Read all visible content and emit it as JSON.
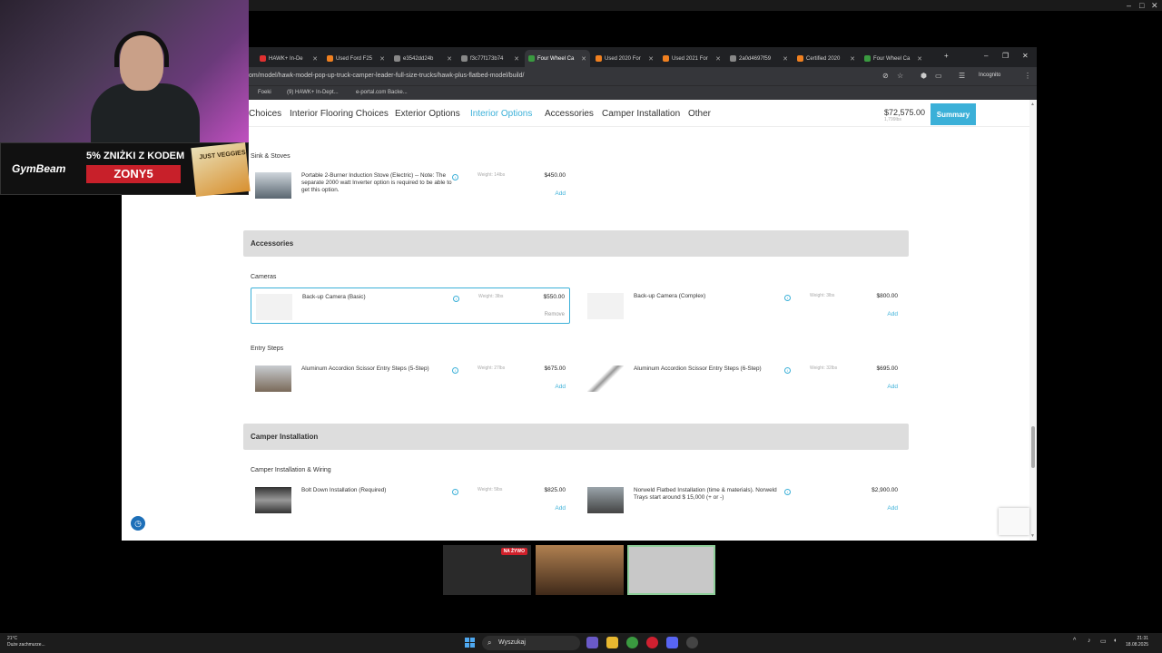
{
  "browser": {
    "tabs": [
      {
        "title": "HAWK+ In-De",
        "color": "#e03030"
      },
      {
        "title": "Used Ford F25",
        "color": "#f08020"
      },
      {
        "title": "e3542dd24b",
        "color": "#888888"
      },
      {
        "title": "f3c77f173b74",
        "color": "#888888"
      },
      {
        "title": "Four Wheel Ca",
        "color": "#3a9a40",
        "active": true
      },
      {
        "title": "Used 2020 For",
        "color": "#f08020"
      },
      {
        "title": "Used 2021 For",
        "color": "#f08020"
      },
      {
        "title": "2a0d4697f59",
        "color": "#888888"
      },
      {
        "title": "Certified 2020",
        "color": "#f08020"
      },
      {
        "title": "Four Wheel Ca",
        "color": "#3a9a40"
      }
    ],
    "url": "om/model/hawk-model-pop-up-truck-camper-leader-full-size-trucks/hawk-plus-flatbed-model/build/",
    "incognito_label": "Incognito",
    "bookmarks": [
      "Foeki",
      "(9) HAWK+ In-Dept...",
      "e-portal.com Backe..."
    ]
  },
  "nav": {
    "items": [
      "Choices",
      "Interior Flooring Choices",
      "Exterior Options",
      "Interior Options",
      "Accessories",
      "Camper Installation",
      "Other"
    ],
    "active_index": 3,
    "total_price": "$72,575.00",
    "total_weight": "1,799lbs",
    "summary_label": "Summary"
  },
  "sections": {
    "sink_stoves": "Sink & Stoves",
    "accessories": "Accessories",
    "cameras": "Cameras",
    "entry_steps": "Entry Steps",
    "camper_installation": "Camper Installation",
    "camper_wiring": "Camper Installation & Wiring"
  },
  "items": {
    "stove": {
      "name": "Portable 2-Burner Induction Stove (Electric) -- Note: The separate 2000 watt Inverter option is required to be able to get this option.",
      "weight": "Weight: 14lbs",
      "price": "$450.00",
      "action": "Add"
    },
    "cam_basic": {
      "name": "Back-up Camera (Basic)",
      "weight": "Weight: 3lbs",
      "price": "$550.00",
      "action": "Remove"
    },
    "cam_complex": {
      "name": "Back-up Camera (Complex)",
      "weight": "Weight: 3lbs",
      "price": "$800.00",
      "action": "Add"
    },
    "steps5": {
      "name": "Aluminum Accordion Scissor Entry Steps (5-Step)",
      "weight": "Weight: 27lbs",
      "price": "$675.00",
      "action": "Add"
    },
    "steps6": {
      "name": "Aluminum Accordion Scissor Entry Steps (6-Step)",
      "weight": "Weight: 32lbs",
      "price": "$695.00",
      "action": "Add"
    },
    "boltdown": {
      "name": "Bolt Down Installation (Required)",
      "weight": "Weight: 5lbs",
      "price": "$825.00",
      "action": "Add"
    },
    "norweld": {
      "name": "Norweld Flatbed Installation (time & materials). Norweld Trays start around $ 15,000 (+ or -)",
      "weight": "",
      "price": "$2,900.00",
      "action": "Add"
    }
  },
  "ad": {
    "brand": "GymBeam",
    "line1": "5% ZNIŻKI Z KODEM",
    "code": "ZONY5",
    "pack_text": "JUST VEGGIES"
  },
  "participants": {
    "live_label": "NA ŻYWO"
  },
  "taskbar": {
    "weather_temp": "21°C",
    "weather_desc": "Duże zachmurze...",
    "search_label": "Wyszukaj",
    "time": "21:31",
    "date": "18.08.2025"
  }
}
